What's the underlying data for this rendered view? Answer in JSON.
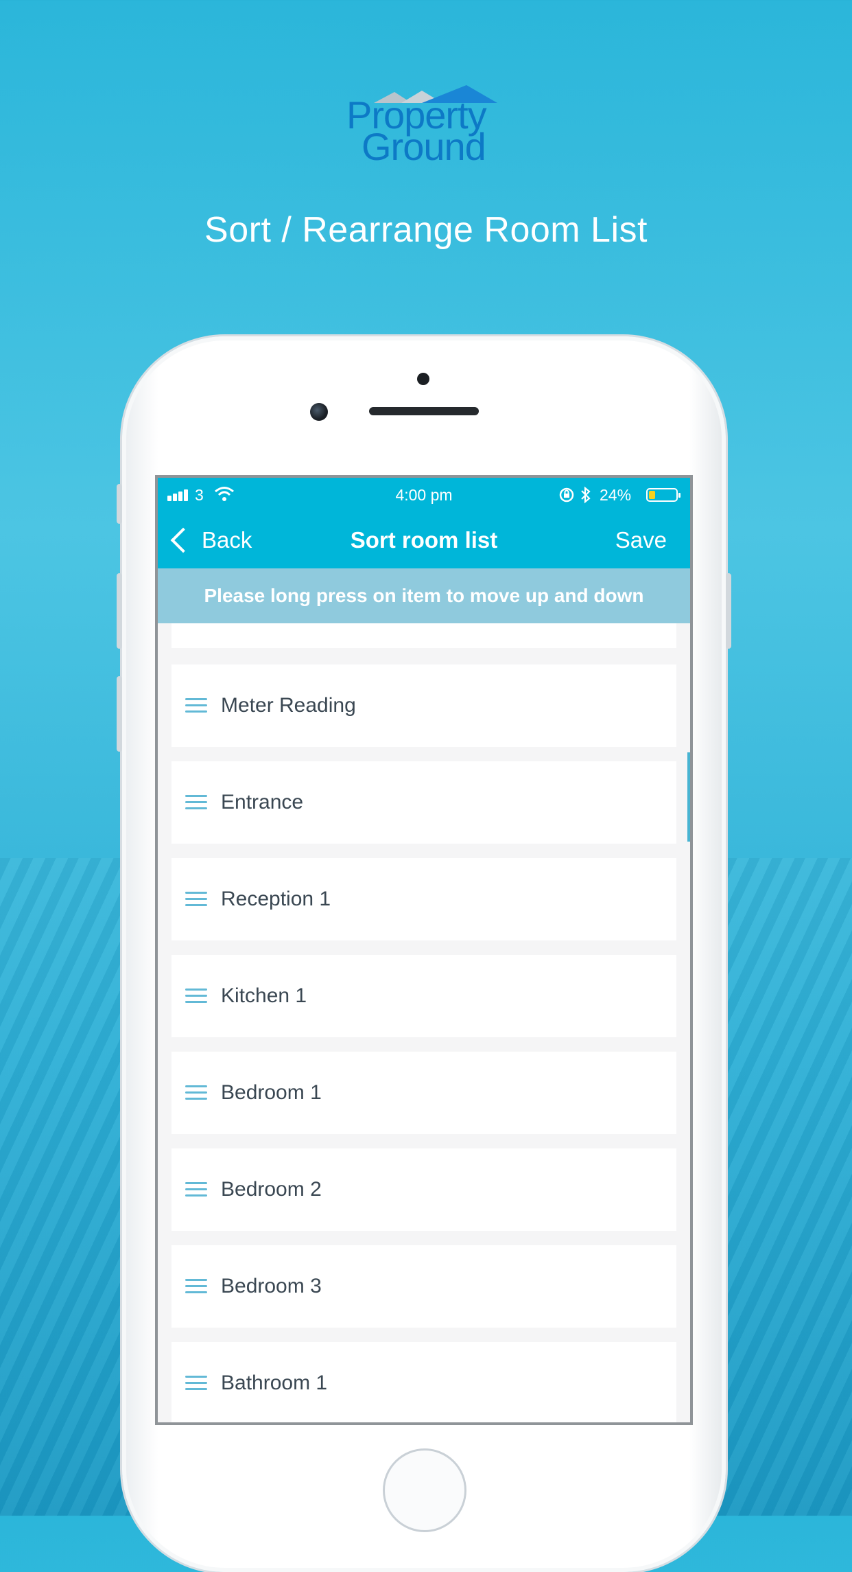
{
  "brand": {
    "line1": "Property",
    "line2": "Ground"
  },
  "headline": "Sort / Rearrange Room List",
  "status_bar": {
    "carrier": "3",
    "time": "4:00 pm",
    "battery": "24%",
    "battery_level": 0.24
  },
  "nav": {
    "back_label": "Back",
    "title": "Sort room list",
    "save_label": "Save"
  },
  "hint": "Please long press on item to move up and down",
  "rooms": [
    {
      "label": "Meter Reading"
    },
    {
      "label": "Entrance"
    },
    {
      "label": "Reception 1"
    },
    {
      "label": "Kitchen 1"
    },
    {
      "label": "Bedroom 1"
    },
    {
      "label": "Bedroom 2"
    },
    {
      "label": "Bedroom 3"
    },
    {
      "label": "Bathroom 1"
    }
  ],
  "icons": {
    "drag_handle": "drag-handle-icon",
    "back": "chevron-left-icon",
    "wifi": "wifi-icon",
    "bluetooth": "bluetooth-icon",
    "rotation_lock": "rotation-lock-icon",
    "battery": "battery-icon",
    "signal": "signal-icon"
  },
  "colors": {
    "accent": "#00b6d9",
    "hint_bg": "#8fcadd",
    "brand_blue": "#0d79c6"
  }
}
